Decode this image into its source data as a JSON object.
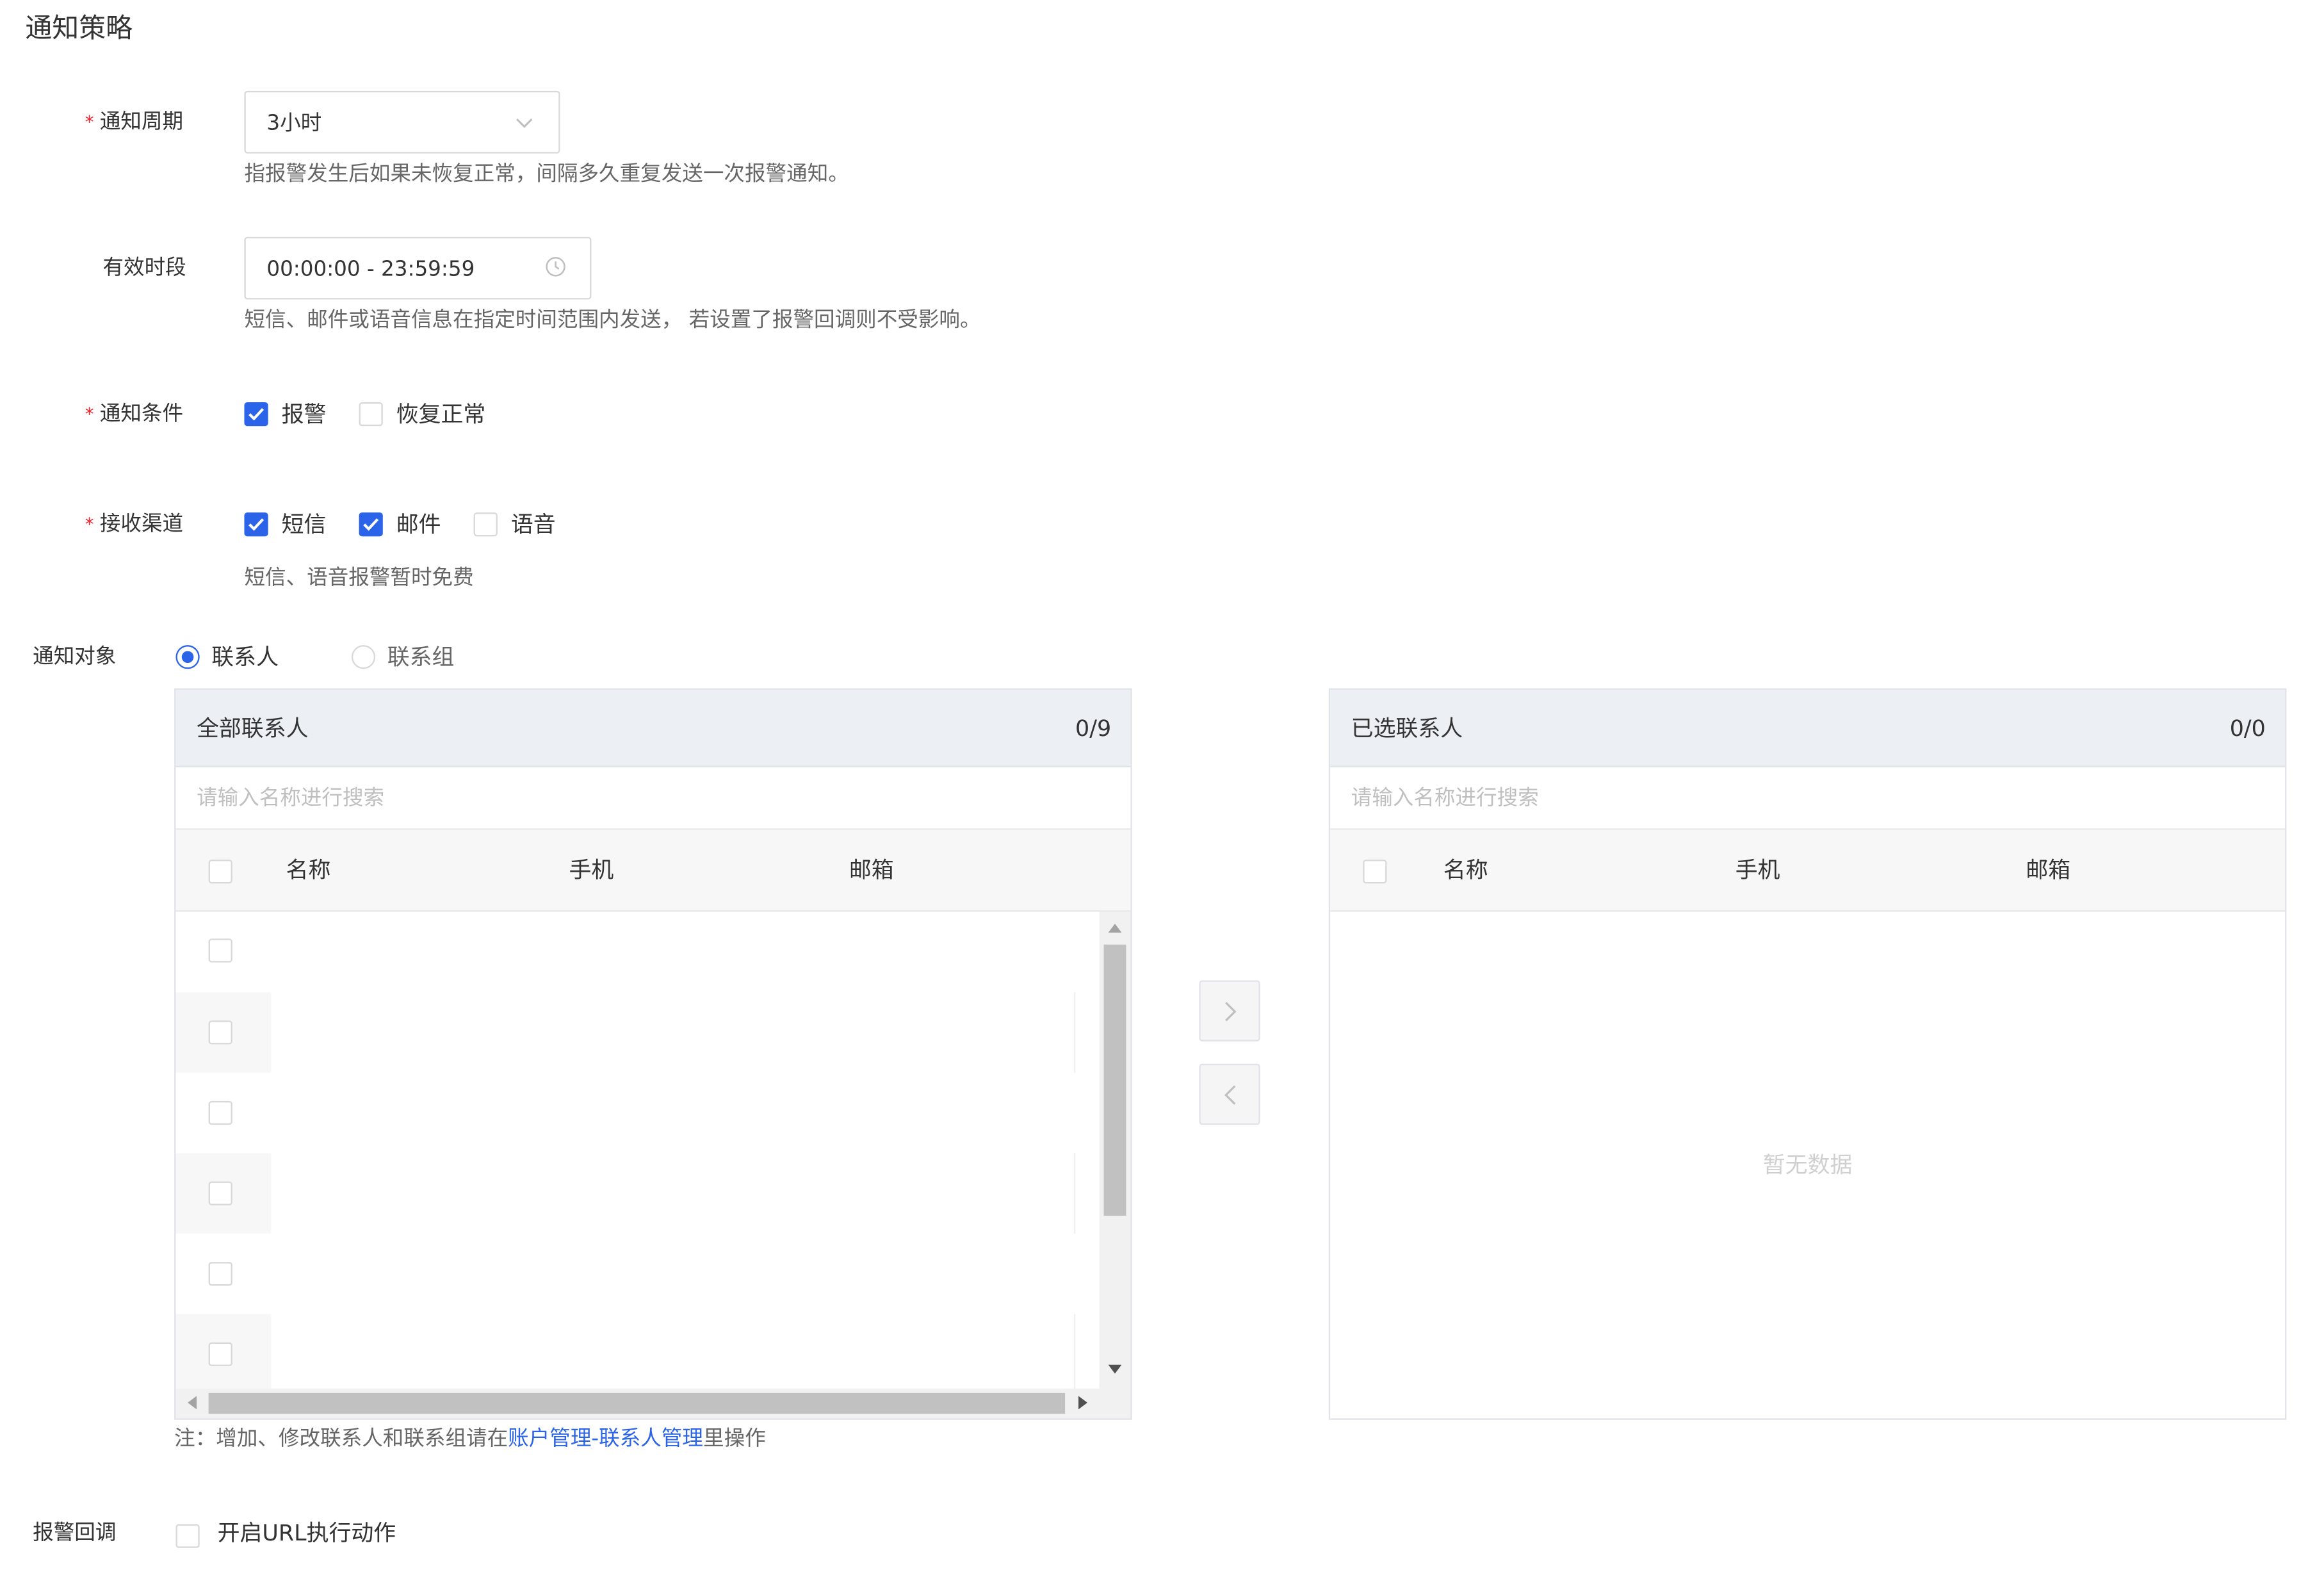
{
  "section_title": "通知策略",
  "notify_period": {
    "label": "通知周期",
    "required_mark": "*",
    "value": "3小时",
    "hint": "指报警发生后如果未恢复正常，间隔多久重复发送一次报警通知。",
    "icon": "chevron-down-icon"
  },
  "effective_time": {
    "label": "有效时段",
    "value": "00:00:00 - 23:59:59",
    "hint": "短信、邮件或语音信息在指定时间范围内发送， 若设置了报警回调则不受影响。",
    "icon": "clock-icon"
  },
  "notify_condition": {
    "label": "通知条件",
    "required_mark": "*",
    "options": [
      {
        "label": "报警",
        "checked": true
      },
      {
        "label": "恢复正常",
        "checked": false
      }
    ]
  },
  "channels": {
    "label": "接收渠道",
    "required_mark": "*",
    "options": [
      {
        "label": "短信",
        "checked": true
      },
      {
        "label": "邮件",
        "checked": true
      },
      {
        "label": "语音",
        "checked": false
      }
    ],
    "hint": "短信、语音报警暂时免费"
  },
  "notify_target": {
    "label": "通知对象",
    "options": [
      {
        "label": "联系人",
        "selected": true
      },
      {
        "label": "联系组",
        "selected": false
      }
    ]
  },
  "transfer": {
    "left": {
      "title": "全部联系人",
      "count": "0/9",
      "search_placeholder": "请输入名称进行搜索",
      "columns": [
        "名称",
        "手机",
        "邮箱"
      ],
      "row_count_visible": 6
    },
    "right": {
      "title": "已选联系人",
      "count": "0/0",
      "search_placeholder": "请输入名称进行搜索",
      "columns": [
        "名称",
        "手机",
        "邮箱"
      ],
      "empty_text": "暂无数据"
    },
    "buttons": {
      "right_icon": "chevron-right-icon",
      "left_icon": "chevron-left-icon"
    }
  },
  "note": {
    "prefix": "注：增加、修改联系人和联系组请在",
    "link": "账户管理-联系人管理",
    "suffix": "里操作"
  },
  "callback": {
    "label": "报警回调",
    "option": {
      "label": "开启URL执行动作",
      "checked": false
    }
  },
  "colors": {
    "primary": "#2b64e8",
    "required": "#f5222d",
    "panel_header": "#eceff3"
  }
}
